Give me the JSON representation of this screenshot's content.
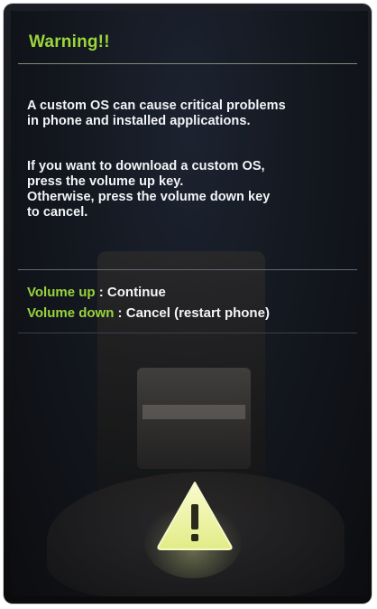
{
  "screen": {
    "title": "Warning!!",
    "message_paragraph_1": [
      "A custom OS can cause critical problems",
      "in phone and installed applications."
    ],
    "message_paragraph_2": [
      "If you want to download a custom OS,",
      "press the volume up key.",
      "Otherwise, press the volume down key",
      "to cancel."
    ],
    "keys": [
      {
        "key": "Volume up",
        "separator": " : ",
        "action": "Continue"
      },
      {
        "key": "Volume down",
        "separator": " : ",
        "action": "Cancel (restart phone)"
      }
    ],
    "icon": "warning-triangle-icon"
  },
  "colors": {
    "accent_green": "#9bd63b",
    "text_white": "#f2f4f7",
    "warning_yellow": "#e8f08c"
  }
}
